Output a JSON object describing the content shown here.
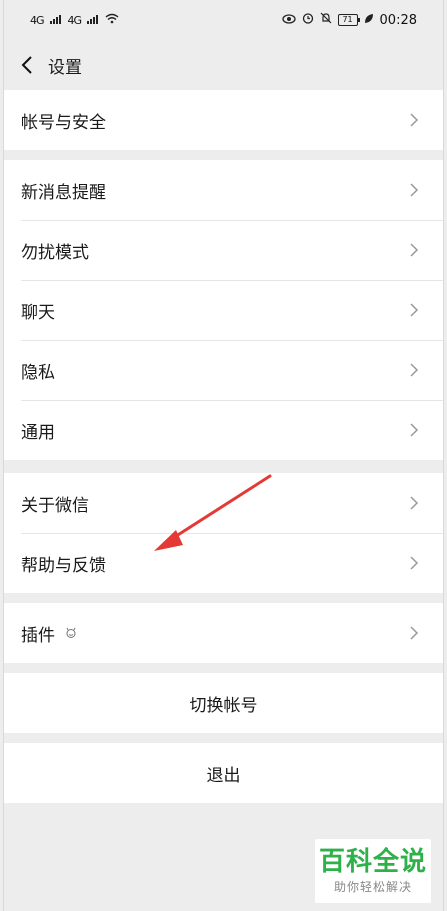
{
  "status_bar": {
    "signal1": "4G",
    "signal2": "4G",
    "battery": "71",
    "time": "00:28"
  },
  "nav": {
    "title": "设置"
  },
  "groups": [
    {
      "items": [
        {
          "label": "帐号与安全"
        }
      ]
    },
    {
      "items": [
        {
          "label": "新消息提醒"
        },
        {
          "label": "勿扰模式"
        },
        {
          "label": "聊天"
        },
        {
          "label": "隐私"
        },
        {
          "label": "通用"
        }
      ]
    },
    {
      "items": [
        {
          "label": "关于微信"
        },
        {
          "label": "帮助与反馈"
        }
      ]
    },
    {
      "items": [
        {
          "label": "插件"
        }
      ]
    },
    {
      "items": [
        {
          "label": "切换帐号"
        }
      ]
    },
    {
      "items": [
        {
          "label": "退出"
        }
      ]
    }
  ],
  "watermark": {
    "title": "百科全说",
    "subtitle": "助你轻松解决"
  },
  "colors": {
    "background": "#ededed",
    "card": "#ffffff",
    "arrow": "#e53935",
    "watermark": "#2fb14a"
  }
}
